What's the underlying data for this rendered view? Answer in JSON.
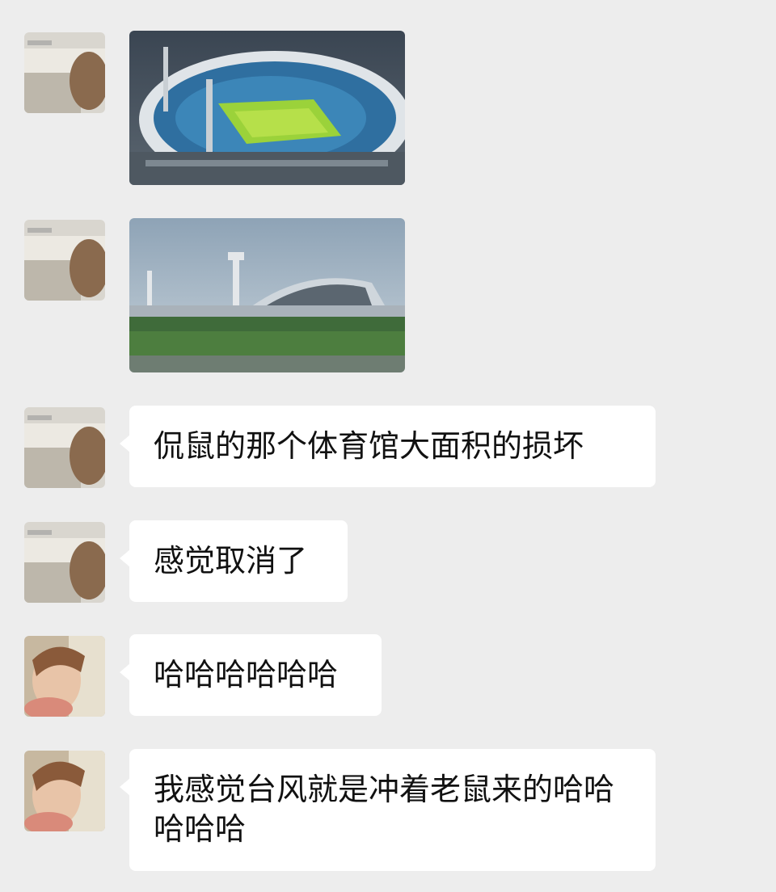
{
  "chat": {
    "messages": [
      {
        "type": "image",
        "sender": "contact-a",
        "image": "stadium-aerial-photo"
      },
      {
        "type": "image",
        "sender": "contact-a",
        "image": "stadium-riverside-photo"
      },
      {
        "type": "text",
        "sender": "contact-a",
        "text": "侃鼠的那个体育馆大面积的损坏"
      },
      {
        "type": "text",
        "sender": "contact-a",
        "text": "感觉取消了"
      },
      {
        "type": "text",
        "sender": "contact-b",
        "text": "哈哈哈哈哈哈"
      },
      {
        "type": "text",
        "sender": "contact-b",
        "text": "我感觉台风就是冲着老鼠来的哈哈哈哈哈"
      }
    ]
  },
  "colors": {
    "background": "#ededed",
    "bubble": "#ffffff",
    "text": "#111111"
  }
}
